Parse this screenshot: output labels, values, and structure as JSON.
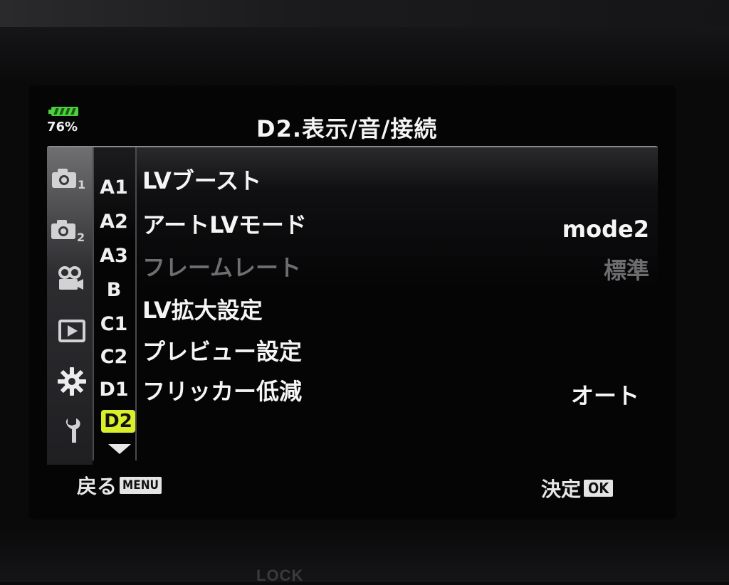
{
  "status": {
    "battery_percent_label": "76%",
    "battery_level": 0.76,
    "battery_color": "#4ad13d"
  },
  "header": {
    "title": "D2.表示/音/接続"
  },
  "categories": [
    {
      "icon": "camera-icon",
      "sub": "1"
    },
    {
      "icon": "camera-icon",
      "sub": "2"
    },
    {
      "icon": "video-camera-icon",
      "sub": ""
    },
    {
      "icon": "playback-icon",
      "sub": ""
    },
    {
      "icon": "gear-icon",
      "sub": ""
    },
    {
      "icon": "wrench-icon",
      "sub": ""
    }
  ],
  "submenus": [
    "A1",
    "A2",
    "A3",
    "B",
    "C1",
    "C2",
    "D1",
    "D2"
  ],
  "active_submenu": "D2",
  "active_color": "#d9ef2c",
  "items": [
    {
      "label": "LVブースト",
      "value": ""
    },
    {
      "label": "アートLVモード",
      "value": "mode2"
    },
    {
      "label": "フレームレート",
      "value": "標準",
      "disabled": true
    },
    {
      "label": "LV拡大設定",
      "value": ""
    },
    {
      "label": "プレビュー設定",
      "value": ""
    },
    {
      "label": "フリッカー低減",
      "value": "オート"
    }
  ],
  "footer": {
    "back_label": "戻る",
    "back_key": "MENU",
    "confirm_label": "決定",
    "confirm_key": "OK"
  },
  "bezel": {
    "lock_label": "LOCK"
  }
}
